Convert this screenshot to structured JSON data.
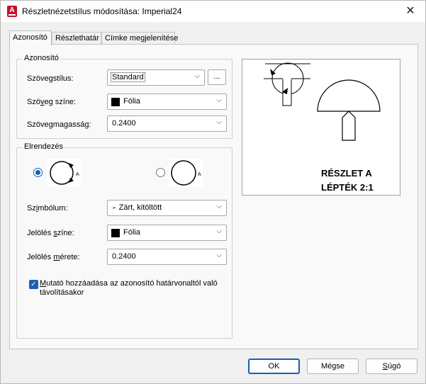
{
  "window": {
    "title": "Részletnézetstílus módosítása: Imperial24",
    "app_icon": "autocad-icon",
    "close_glyph": "✕"
  },
  "tabs": [
    {
      "label": "Azonosító",
      "active": true
    },
    {
      "label": "Részlethatár",
      "active": false
    },
    {
      "label": "Címke megjelenítése",
      "active": false
    }
  ],
  "identifier_group": {
    "title": "Azonosító",
    "text_style": {
      "label_pre": "Szöve",
      "label_u": "g",
      "label_post": "stílus:",
      "value": "Standard",
      "browse_label": "..."
    },
    "text_color": {
      "label_pre": "Szö",
      "label_u": "v",
      "label_post": "eg színe:",
      "value": "Fólia",
      "swatch_color": "#000000"
    },
    "text_height": {
      "label_pre": "Szövegma",
      "label_u": "g",
      "label_post": "asság:",
      "value": "0.2400"
    }
  },
  "layout_group": {
    "title": "Elrendezés",
    "option1_letter": "A",
    "option2_letter": "A",
    "selected_option": 1,
    "symbol": {
      "label_pre": "Sz",
      "label_u": "i",
      "label_post": "mbólum:",
      "value": "Zárt, kitöltött",
      "arrow_glyph": "➛"
    },
    "mark_color": {
      "label_pre": "Jelölés ",
      "label_u": "s",
      "label_post": "zíne:",
      "value": "Fólia",
      "swatch_color": "#000000"
    },
    "mark_size": {
      "label_pre": "Jelölés ",
      "label_u": "m",
      "label_post": "érete:",
      "value": "0.2400"
    },
    "leader_checkbox": {
      "checked": true,
      "label_line1_pre": "",
      "label_line1_u": "M",
      "label_line1_post": "utató hozzáadása az azonosító határvonaltól való",
      "label_line2": "távolításakor"
    }
  },
  "preview": {
    "line1": "RÉSZLET A",
    "line2": "LÉPTÉK 2:1"
  },
  "buttons": {
    "ok": "OK",
    "cancel": "Mégse",
    "help_pre": "",
    "help_u": "S",
    "help_post": "úgó"
  },
  "colors": {
    "accent": "#1a5fb4",
    "app_icon": "#c8102e"
  }
}
